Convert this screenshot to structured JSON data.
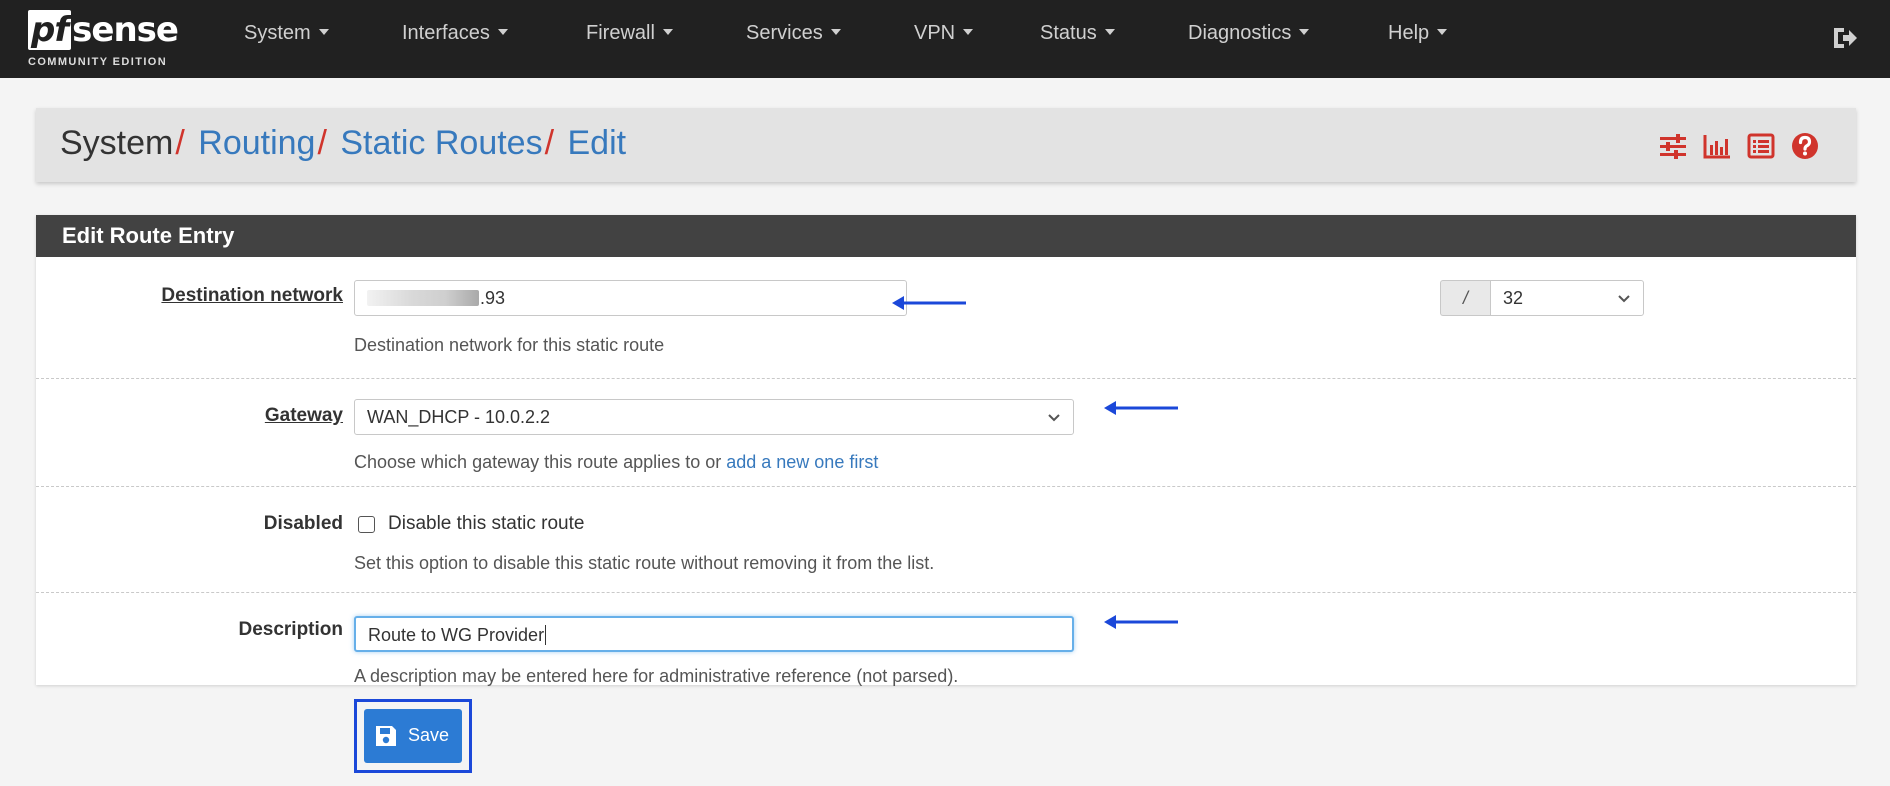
{
  "navbar": {
    "logo_text_pf": "pf",
    "logo_text_sense": "sense",
    "logo_edition": "COMMUNITY EDITION",
    "menus": [
      "System",
      "Interfaces",
      "Firewall",
      "Services",
      "VPN",
      "Status",
      "Diagnostics",
      "Help"
    ],
    "logout_icon": "sign-out-icon"
  },
  "breadcrumb": {
    "items": [
      "System",
      "Routing",
      "Static Routes",
      "Edit"
    ],
    "separator": "/",
    "tool_icons": [
      "sliders-icon",
      "bar-chart-icon",
      "list-icon",
      "help-icon"
    ]
  },
  "colors": {
    "navbar_bg": "#212121",
    "link": "#3779bd",
    "separator": "#d0342c",
    "panel_heading_bg": "#424242",
    "primary_button": "#2c7bd4",
    "annotation_arrow": "#1b48d9"
  },
  "panel": {
    "title": "Edit Route Entry",
    "destination": {
      "label": "Destination network",
      "value_visible": ".93",
      "help": "Destination network for this static route",
      "cidr_prefix": "/",
      "cidr_value": "32"
    },
    "gateway": {
      "label": "Gateway",
      "value": "WAN_DHCP - 10.0.2.2",
      "help_text": "Choose which gateway this route applies to or",
      "help_link": "add a new one first"
    },
    "disabled": {
      "label": "Disabled",
      "checkbox_label": "Disable this static route",
      "checked": false,
      "help": "Set this option to disable this static route without removing it from the list."
    },
    "description": {
      "label": "Description",
      "value": "Route to WG Provider",
      "help": "A description may be entered here for administrative reference (not parsed)."
    }
  },
  "actions": {
    "save_label": "Save",
    "save_icon": "save-icon"
  }
}
